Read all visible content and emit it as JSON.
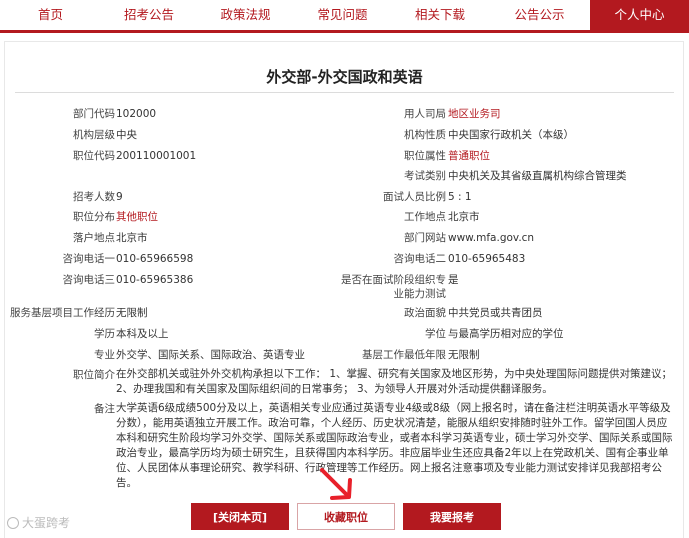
{
  "nav": {
    "items": [
      {
        "label": "首页"
      },
      {
        "label": "招考公告"
      },
      {
        "label": "政策法规"
      },
      {
        "label": "常见问题"
      },
      {
        "label": "相关下载"
      },
      {
        "label": "公告公示"
      },
      {
        "label": "个人中心",
        "active": true
      }
    ]
  },
  "page_title": "外交部-外交国政和英语",
  "fields": {
    "dept_code": {
      "label": "部门代码",
      "value": "102000"
    },
    "employer": {
      "label": "用人司局",
      "value": "地区业务司"
    },
    "org_level": {
      "label": "机构层级",
      "value": "中央"
    },
    "org_nature": {
      "label": "机构性质",
      "value": "中央国家行政机关（本级）"
    },
    "post_code": {
      "label": "职位代码",
      "value": "200110001001"
    },
    "post_attr": {
      "label": "职位属性",
      "value": "普通职位"
    },
    "exam_type": {
      "label": "考试类别",
      "value": "中央机关及其省级直属机构综合管理类"
    },
    "headcount": {
      "label": "招考人数",
      "value": "9"
    },
    "interview_ratio": {
      "label": "面试人员比例",
      "value": "5 : 1"
    },
    "post_dist": {
      "label": "职位分布",
      "value": "其他职位"
    },
    "work_place": {
      "label": "工作地点",
      "value": "北京市"
    },
    "hukou": {
      "label": "落户地点",
      "value": "北京市"
    },
    "website": {
      "label": "部门网站",
      "value": "www.mfa.gov.cn"
    },
    "phone1": {
      "label": "咨询电话一",
      "value": "010-65966598"
    },
    "phone2": {
      "label": "咨询电话二",
      "value": "010-65965483"
    },
    "phone3": {
      "label": "咨询电话三",
      "value": "010-65965386"
    },
    "pro_test": {
      "label": "是否在面试阶段组织专业能力测试",
      "label_line1": "是否在面试阶段组织专",
      "label_line2": "业能力测试",
      "value": "是"
    },
    "grassroots_project": {
      "label": "服务基层项目工作经历",
      "value": "无限制"
    },
    "politics": {
      "label": "政治面貌",
      "value": "中共党员或共青团员"
    },
    "education": {
      "label": "学历",
      "value": "本科及以上"
    },
    "degree": {
      "label": "学位",
      "value": "与最高学历相对应的学位"
    },
    "major": {
      "label": "专业",
      "value": "外交学、国际关系、国际政治、英语专业"
    },
    "min_years": {
      "label": "基层工作最低年限",
      "value": "无限制"
    },
    "post_intro": {
      "label": "职位简介",
      "lines": [
        "在外交部机关或驻外外交机构承担以下工作： 1、掌握、研究有关国家及地区形势，为中央处理国际问题提供对策建议；",
        "2、办理我国和有关国家及国际组织间的日常事务； 3、为领导人开展对外活动提供翻译服务。"
      ]
    },
    "remarks": {
      "label": "备注",
      "lines": [
        "大学英语6级成绩500分及以上，英语相关专业应通过英语专业4级或8级（网上报名时，请在备注栏注明英语水平等级及",
        "分数），能用英语独立开展工作。政治可靠，个人经历、历史状况清楚，能服从组织安排随时驻外工作。留学回国人员应",
        "本科和研究生阶段均学习外交学、国际关系或国际政治专业，或者本科学习英语专业，硕士学习外交学、国际关系或国际",
        "政治专业，最高学历均为硕士研究生，且获得国内本科学历。非应届毕业生还应具备2年以上在党政机关、国有企事业单",
        "位、人民团体从事理论研究、教学科研、行政管理等工作经历。网上报名注意事项及专业能力测试安排详见我部招考公",
        "告。"
      ]
    }
  },
  "buttons": {
    "close": "[关闭本页]",
    "favorite": "收藏职位",
    "apply": "我要报考"
  },
  "watermark": "大蛋跨考",
  "colors": {
    "brand_red": "#b3191f",
    "text": "#333333"
  },
  "icons": {
    "annotation": "red-arrow-icon",
    "watermark": "logo-icon"
  }
}
